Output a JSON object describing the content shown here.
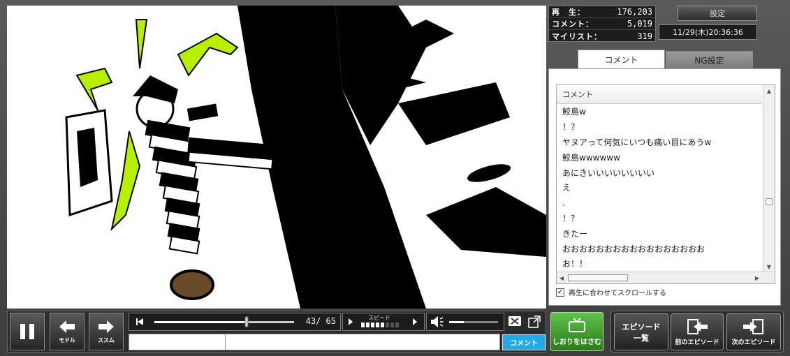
{
  "stats": {
    "plays_label": "再　生：",
    "plays_value": "176,203",
    "comments_label": "コメント：",
    "comments_value": "5,019",
    "mylist_label": "マイリスト：",
    "mylist_value": "319"
  },
  "header": {
    "settings_label": "設定",
    "datetime": "11/29(木)20:36:36"
  },
  "tabs": [
    {
      "label": "コメント",
      "active": true
    },
    {
      "label": "NG設定",
      "active": false
    }
  ],
  "comments": {
    "column_header": "コメント",
    "items": [
      "鮫島w",
      "！？",
      "ヤヌアって何気にいつも痛い目にあうw",
      "鮫島wwwwww",
      "あにきいいいいいいいい",
      "え",
      ".",
      "！？",
      "きたー",
      "おおおおおおおおおおおおおおおおお",
      "お！！"
    ],
    "sync_scroll_label": "再生に合わせてスクロールする",
    "sync_scroll_checked": true
  },
  "controls": {
    "back_label": "モドル",
    "forward_label": "ススム",
    "current_time": "43",
    "total_time": "65",
    "seek_progress": 0.66,
    "speed_label": "スピード",
    "volume_level": 0.3,
    "comment_submit_label": "コメント",
    "bookmark_label": "しおりをはさむ",
    "episode_list_label_1": "エピソード",
    "episode_list_label_2": "一覧",
    "prev_episode_label": "前のエピソード",
    "next_episode_label": "次のエピソード"
  }
}
